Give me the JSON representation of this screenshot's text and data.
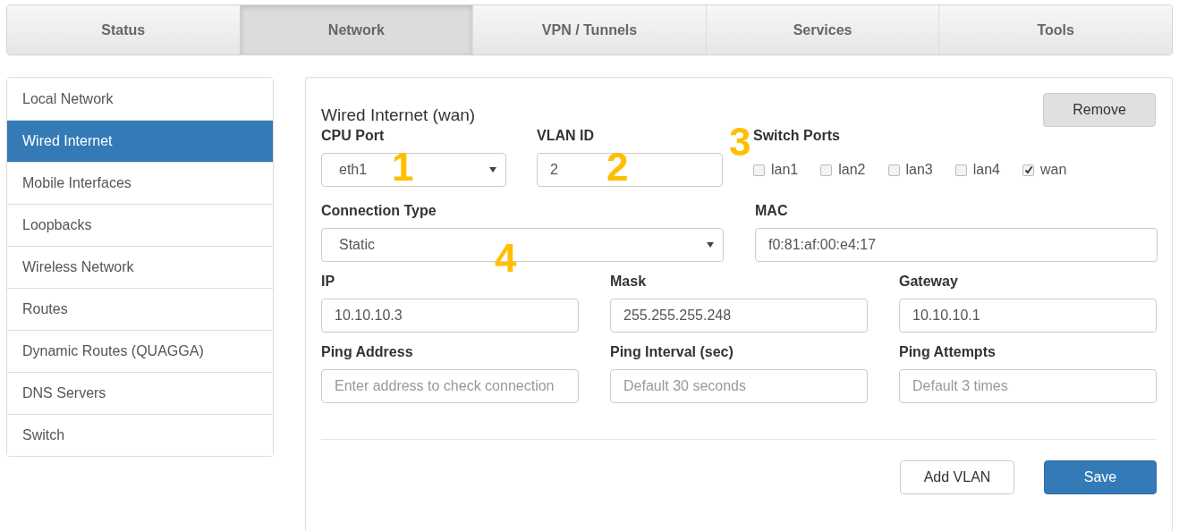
{
  "tabs": [
    {
      "label": "Status",
      "selected": false
    },
    {
      "label": "Network",
      "selected": true
    },
    {
      "label": "VPN / Tunnels",
      "selected": false
    },
    {
      "label": "Services",
      "selected": false
    },
    {
      "label": "Tools",
      "selected": false
    }
  ],
  "sidebar": {
    "items": [
      {
        "label": "Local Network",
        "selected": false
      },
      {
        "label": "Wired Internet",
        "selected": true
      },
      {
        "label": "Mobile Interfaces",
        "selected": false
      },
      {
        "label": "Loopbacks",
        "selected": false
      },
      {
        "label": "Wireless Network",
        "selected": false
      },
      {
        "label": "Routes",
        "selected": false
      },
      {
        "label": "Dynamic Routes (QUAGGA)",
        "selected": false
      },
      {
        "label": "DNS Servers",
        "selected": false
      },
      {
        "label": "Switch",
        "selected": false
      }
    ]
  },
  "panel": {
    "title": "Wired Internet (wan)",
    "remove_button": "Remove",
    "fields": [
      {
        "kind": "select",
        "label": "CPU Port",
        "value": "eth1"
      },
      {
        "kind": "input",
        "label": "VLAN ID",
        "value": "2"
      },
      {
        "kind": "checkboxes",
        "label": "Switch Ports",
        "options": [
          {
            "label": "lan1",
            "checked": false
          },
          {
            "label": "lan2",
            "checked": false
          },
          {
            "label": "lan3",
            "checked": false
          },
          {
            "label": "lan4",
            "checked": false
          },
          {
            "label": "wan",
            "checked": true
          }
        ]
      },
      {
        "kind": "select",
        "label": "Connection Type",
        "value": "Static"
      },
      {
        "kind": "input",
        "label": "MAC",
        "value": "f0:81:af:00:e4:17"
      },
      {
        "kind": "input",
        "label": "IP",
        "value": "10.10.10.3"
      },
      {
        "kind": "input",
        "label": "Mask",
        "value": "255.255.255.248"
      },
      {
        "kind": "input",
        "label": "Gateway",
        "value": "10.10.10.1"
      },
      {
        "kind": "input",
        "label": "Ping Address",
        "placeholder": "Enter address to check connection"
      },
      {
        "kind": "input",
        "label": "Ping Interval (sec)",
        "placeholder": "Default 30 seconds"
      },
      {
        "kind": "input",
        "label": "Ping Attempts",
        "placeholder": "Default 3 times"
      }
    ],
    "buttons": [
      {
        "label": "Add VLAN",
        "primary": false
      },
      {
        "label": "Save",
        "primary": true
      }
    ]
  },
  "annotations": [
    {
      "text": "1"
    },
    {
      "text": "2"
    },
    {
      "text": "3"
    },
    {
      "text": "4"
    }
  ]
}
